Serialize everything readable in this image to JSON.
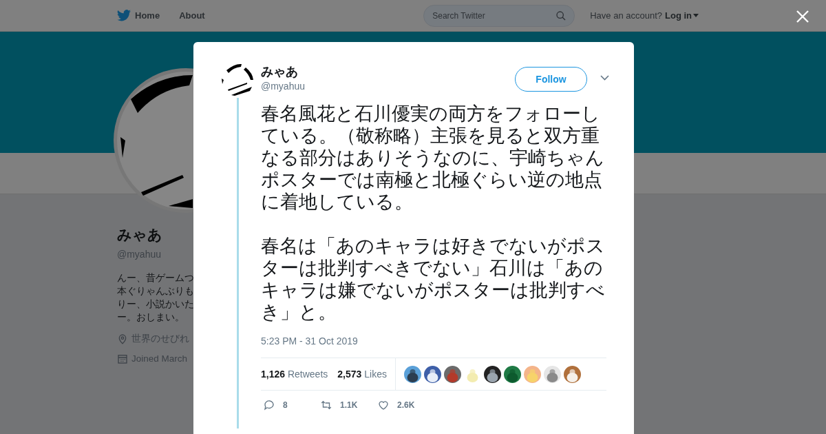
{
  "top_nav": {
    "links": [
      {
        "label": "Home",
        "kind": "home"
      },
      {
        "label": "About",
        "kind": "plain"
      }
    ],
    "search": {
      "placeholder": "Search Twitter"
    },
    "account_prompt": "Have an account?",
    "login": "Log in"
  },
  "profile": {
    "name": "みゃあ",
    "handle": "@myahuu",
    "bio_lines": [
      "んー、昔ゲームつ",
      "本ぐりゃんぶりも",
      "りー、小説かいた",
      "ー。おしまい。"
    ],
    "location": "世界のせびれ",
    "joined": "Joined March"
  },
  "tweet": {
    "name": "みゃあ",
    "handle": "@myahuu",
    "follow": "Follow",
    "paragraphs": [
      "春名風花と石川優実の両方をフォローしている。（敬称略）主張を見ると双方重なる部分はありそうなのに、宇崎ちゃんポスターでは南極と北極ぐらい逆の地点に着地している。",
      "春名は「あのキャラは好きでないがポスターは批判すべきでない」石川は「あのキャラは嫌でないがポスターは批判すべき」と。"
    ],
    "time": "5:23 PM - 31 Oct 2019",
    "stats": [
      {
        "count": "1,126",
        "label": "Retweets"
      },
      {
        "count": "2,573",
        "label": "Likes"
      }
    ],
    "liker_avatars": [
      {
        "kind": "picture"
      },
      {
        "kind": "picture"
      },
      {
        "kind": "picture"
      },
      {
        "kind": "picture"
      },
      {
        "kind": "picture"
      },
      {
        "kind": "picture"
      },
      {
        "kind": "picture"
      },
      {
        "kind": "picture"
      },
      {
        "kind": "picture"
      }
    ],
    "actions": [
      {
        "kind": "reply",
        "count": "8"
      },
      {
        "kind": "retweet",
        "count": "1.1K"
      },
      {
        "kind": "like",
        "count": "2.6K"
      }
    ]
  }
}
